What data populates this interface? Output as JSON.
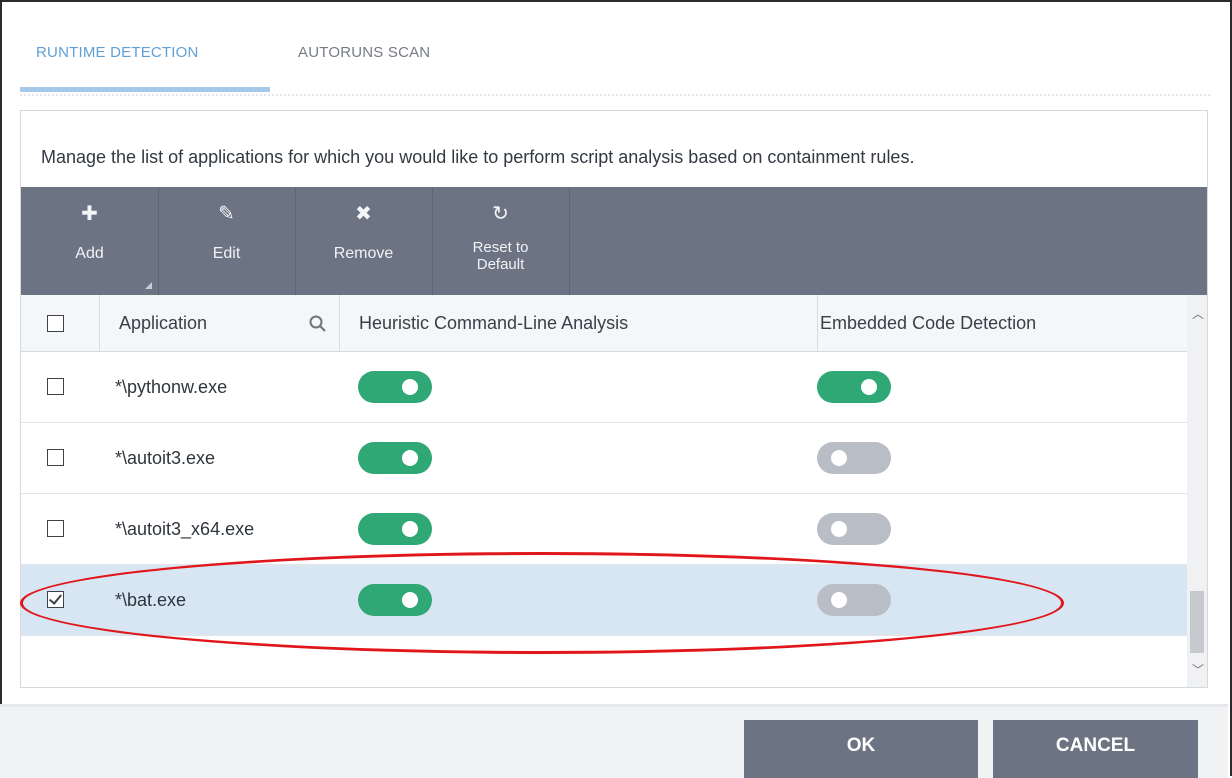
{
  "tabs": [
    {
      "label": "RUNTIME DETECTION",
      "active": true
    },
    {
      "label": "AUTORUNS SCAN",
      "active": false
    }
  ],
  "description": "Manage the list of applications for which you would like to perform script analysis based on containment rules.",
  "toolbar": {
    "add": {
      "label": "Add",
      "icon": "plus-icon"
    },
    "edit": {
      "label": "Edit",
      "icon": "pencil-icon"
    },
    "remove": {
      "label": "Remove",
      "icon": "x-icon"
    },
    "reset": {
      "label_line1": "Reset to",
      "label_line2": "Default",
      "icon": "refresh-icon"
    }
  },
  "table": {
    "columns": {
      "application": "Application",
      "heuristic": "Heuristic Command-Line Analysis",
      "embedded": "Embedded Code Detection"
    },
    "rows": [
      {
        "name": "*\\pythonw.exe",
        "checked": false,
        "heuristic": true,
        "embedded": true
      },
      {
        "name": "*\\autoit3.exe",
        "checked": false,
        "heuristic": true,
        "embedded": false
      },
      {
        "name": "*\\autoit3_x64.exe",
        "checked": false,
        "heuristic": true,
        "embedded": false
      },
      {
        "name": "*\\bat.exe",
        "checked": true,
        "heuristic": true,
        "embedded": false,
        "selected": true
      }
    ]
  },
  "buttons": {
    "ok": "OK",
    "cancel": "CANCEL"
  },
  "colors": {
    "accent": "#5f9fd6",
    "toolbar": "#6c7383",
    "toggle_on": "#2fa876",
    "toggle_off": "#b9bdc5",
    "selected_row": "#d8e6f4",
    "annotation": "#e0161b"
  }
}
